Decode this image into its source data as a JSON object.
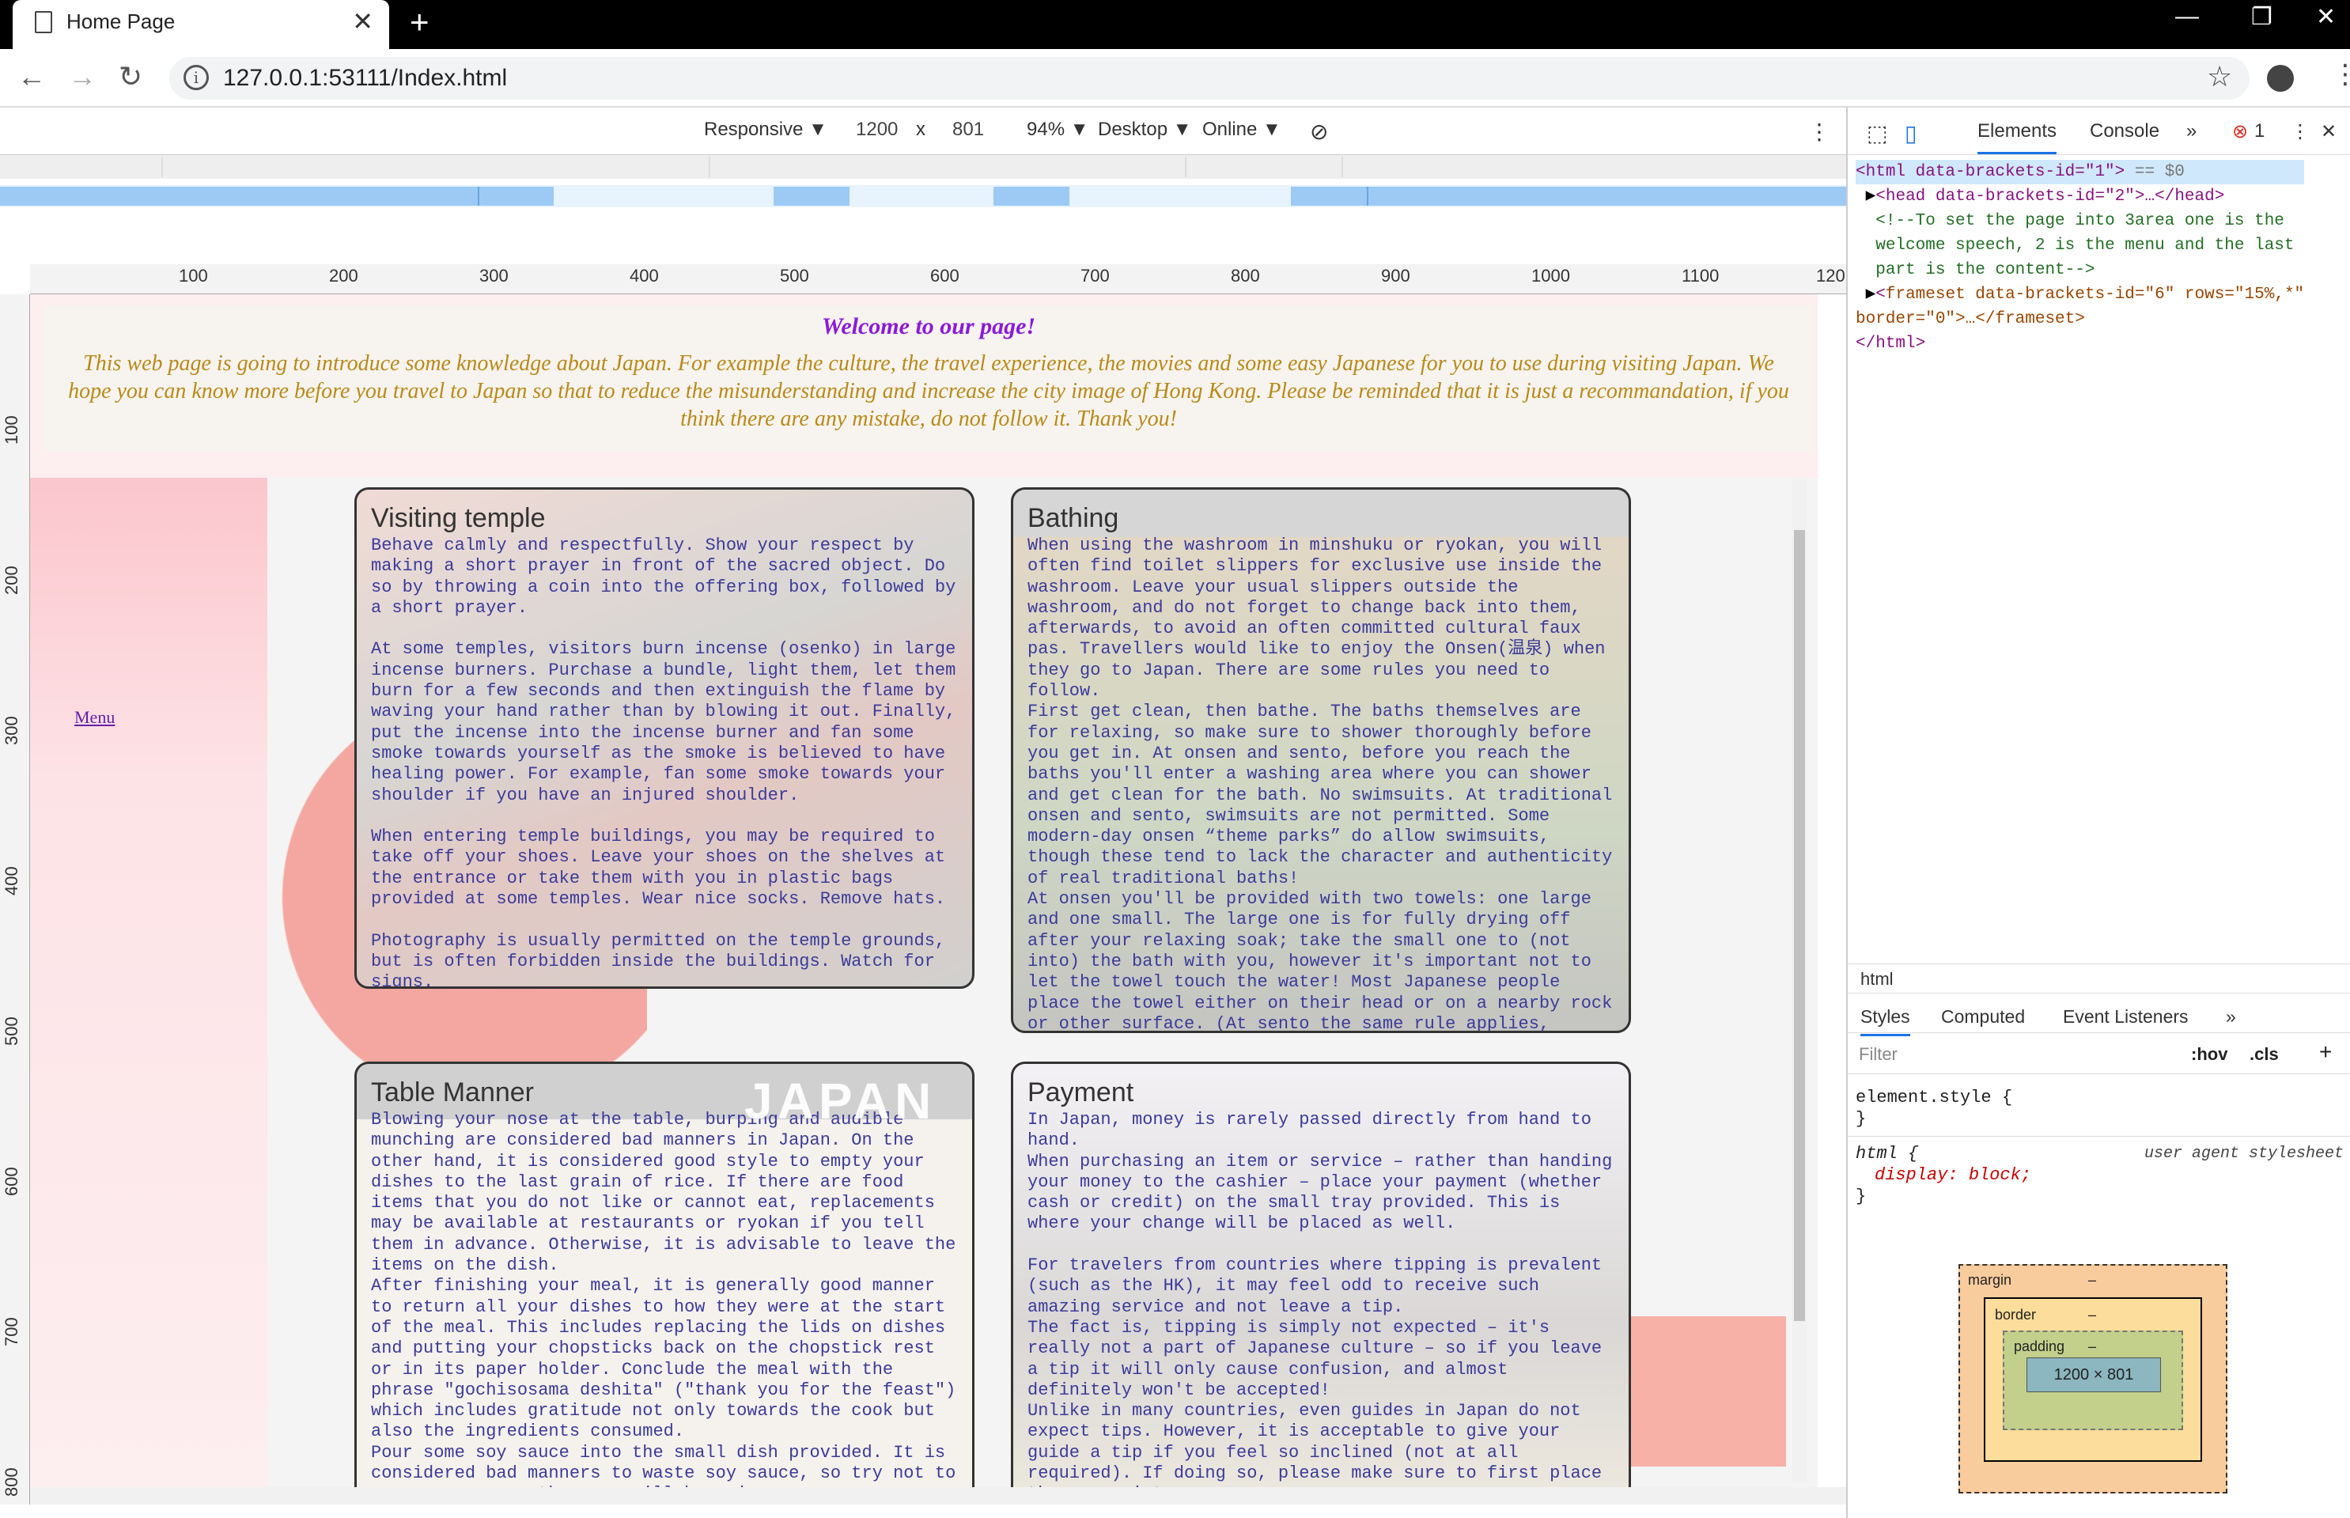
{
  "browser": {
    "tab_title": "Home Page",
    "url": "127.0.0.1:53111/Index.html"
  },
  "devbar": {
    "device": "Responsive ▼",
    "width": "1200",
    "x": "x",
    "height": "801",
    "zoom": "94% ▼",
    "mode": "Desktop ▼",
    "network": "Online ▼"
  },
  "ruler": {
    "top": [
      "100",
      "200",
      "300",
      "400",
      "500",
      "600",
      "700",
      "800",
      "900",
      "1000",
      "1100",
      "120"
    ],
    "left": [
      "100",
      "200",
      "300",
      "400",
      "500",
      "600",
      "700",
      "800"
    ]
  },
  "page": {
    "welcome_title": "Welcome to our page!",
    "welcome_text": "This web page is going to introduce some knowledge about Japan. For example the culture, the travel experience, the movies and some easy Japanese for you to use during visiting Japan. We hope you can know more before you travel to Japan so that to reduce the misunderstanding and increase the city image of Hong Kong. Please be reminded that it is just a recommandation, if you think there are any mistake, do not follow it. Thank you!",
    "menu_link": "Menu",
    "cards": [
      {
        "title": "Visiting temple",
        "text": "Behave calmly and respectfully. Show your respect by making a short prayer in front of the sacred object. Do so by throwing a coin into the offering box, followed by a short prayer.\n\nAt some temples, visitors burn incense (osenko) in large incense burners. Purchase a bundle, light them, let them burn for a few seconds and then extinguish the flame by waving your hand rather than by blowing it out. Finally, put the incense into the incense burner and fan some smoke towards yourself as the smoke is believed to have healing power. For example, fan some smoke towards your shoulder if you have an injured shoulder.\n\nWhen entering temple buildings, you may be required to take off your shoes. Leave your shoes on the shelves at the entrance or take them with you in plastic bags provided at some temples. Wear nice socks. Remove hats.\n\nPhotography is usually permitted on the temple grounds, but is often forbidden inside the buildings. Watch for signs."
      },
      {
        "title": "Bathing",
        "text": "When using the washroom in minshuku or ryokan, you will often find toilet slippers for exclusive use inside the washroom. Leave your usual slippers outside the washroom, and do not forget to change back into them, afterwards, to avoid an often committed cultural faux pas. Travellers would like to enjoy the Onsen(温泉) when they go to Japan. There are some rules you need to follow.\nFirst get clean, then bathe. The baths themselves are for relaxing, so make sure to shower thoroughly before you get in. At onsen and sento, before you reach the baths you'll enter a washing area where you can shower and get clean for the bath. No swimsuits. At traditional onsen and sento, swimsuits are not permitted. Some modern-day onsen “theme parks” do allow swimsuits, though these tend to lack the character and authenticity of real traditional baths!\nAt onsen you'll be provided with two towels: one large and one small. The large one is for fully drying off after your relaxing soak; take the small one to (not into) the bath with you, however it's important not to let the towel touch the water! Most Japanese people place the towel either on their head or on a nearby rock or other surface. (At sento the same rule applies, though you typically bring your own towel, or buy one for a small fee at the front desk)."
      },
      {
        "title": "Table Manner",
        "banner": "JAPAN",
        "text": "Blowing your nose at the table, burping and audible munching are considered bad manners in Japan. On the other hand, it is considered good style to empty your dishes to the last grain of rice. If there are food items that you do not like or cannot eat, replacements may be available at restaurants or ryokan if you tell them in advance. Otherwise, it is advisable to leave the items on the dish.\nAfter finishing your meal, it is generally good manner to return all your dishes to how they were at the start of the meal. This includes replacing the lids on dishes and putting your chopsticks back on the chopstick rest or in its paper holder. Conclude the meal with the phrase \"gochisosama deshita\" (\"thank you for the feast\") which includes gratitude not only towards the cook but also the ingredients consumed.\nPour some soy sauce into the small dish provided. It is considered bad manners to waste soy sauce, so try not to pour more sauce than you will be using."
      },
      {
        "title": "Payment",
        "text": "In Japan, money is rarely passed directly from hand to hand.\nWhen purchasing an item or service – rather than handing your money to the cashier – place your payment (whether cash or credit) on the small tray provided. This is where your change will be placed as well.\n\nFor travelers from countries where tipping is prevalent (such as the HK), it may feel odd to receive such amazing service and not leave a tip.\nThe fact is, tipping is simply not expected – it's really not a part of Japanese culture – so if you leave a tip it will only cause confusion, and almost definitely won't be accepted!\nUnlike in many countries, even guides in Japan do not expect tips. However, it is acceptable to give your guide a tip if you feel so inclined (not at all required). If doing so, please make sure to first place the money into an"
      }
    ]
  },
  "devtools": {
    "tabs": [
      "Elements",
      "Console",
      "»"
    ],
    "errors": "1",
    "dom": {
      "l1": "html data-brackets-id=\"1\"",
      "l1b": " == $0",
      "l2": "head data-brackets-id=\"2\">…</head>",
      "l3": "<!--To set the page into 3area one is the",
      "l4": "welcome speech, 2 is the menu and the last",
      "l5": "part is the content-->",
      "l6": "frameset data-brackets-id=\"6\" rows=\"15%,*\"",
      "l7": "border=\"0\">…</frameset>",
      "l8": "</html>"
    },
    "crumb": "html",
    "subtabs": [
      "Styles",
      "Computed",
      "Event Listeners",
      "»"
    ],
    "filter": "Filter",
    "hov": ":hov",
    ".cls": ".cls",
    "rule1": "element.style {",
    "rule1e": "}",
    "rule2": "html {",
    "rule2src": "user agent stylesheet",
    "rule2p": "display: block;",
    "rule2e": "}",
    "box": {
      "margin": "margin",
      "border": "border",
      "padding": "padding",
      "content": "1200 × 801",
      "dash": "–"
    }
  }
}
